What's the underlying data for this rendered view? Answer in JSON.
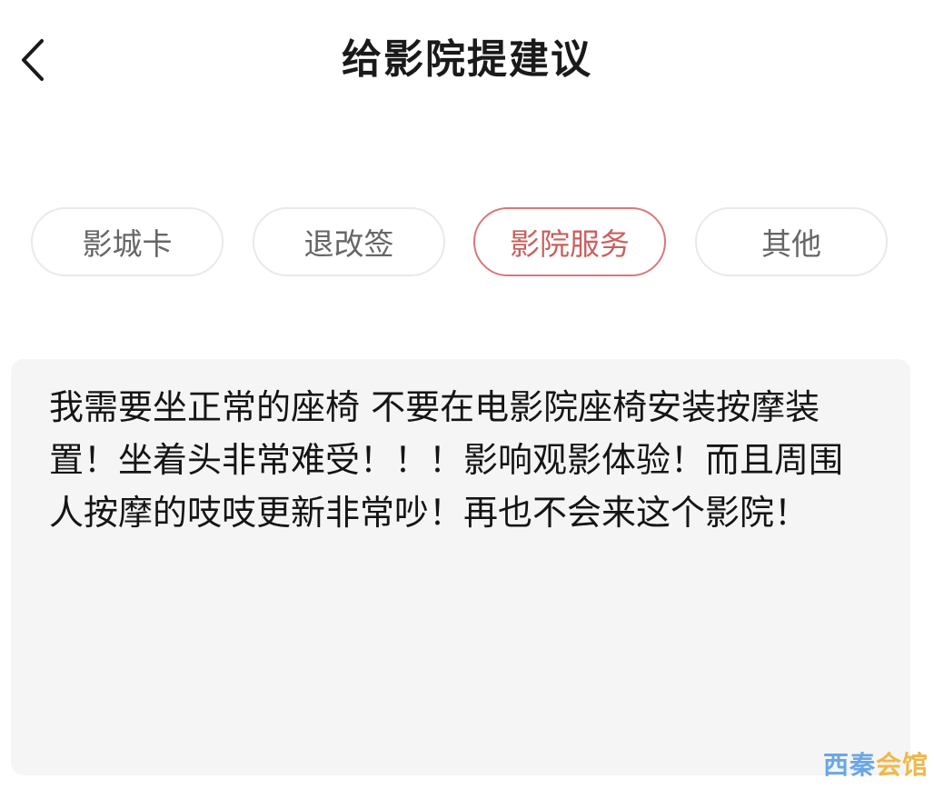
{
  "header": {
    "title": "给影院提建议",
    "back_icon": "chevron-left-icon"
  },
  "categories": [
    {
      "label": "影城卡",
      "selected": false
    },
    {
      "label": "退改签",
      "selected": false
    },
    {
      "label": "影院服务",
      "selected": true
    },
    {
      "label": "其他",
      "selected": false
    }
  ],
  "suggestion": {
    "text": "我需要坐正常的座椅 不要在电影院座椅安装按摩装置！坐着头非常难受！！！影响观影体验！而且周围人按摩的吱吱更新非常吵！再也不会来这个影院！"
  },
  "watermark": {
    "part1": "西秦",
    "part2": "会馆"
  },
  "colors": {
    "accent": "#c9605f",
    "accent_border": "#d9787a",
    "chip_border": "#e9e9e9",
    "input_bg": "#f5f5f5"
  }
}
